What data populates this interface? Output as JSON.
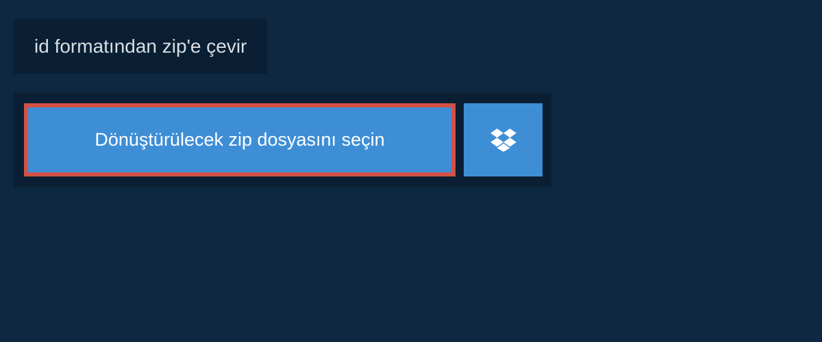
{
  "title": "id formatından zip'e çevir",
  "upload": {
    "select_file_label": "Dönüştürülecek zip dosyasını seçin"
  },
  "colors": {
    "background": "#0d2840",
    "panel": "#0a1f33",
    "button": "#3e8ed6",
    "highlight_border": "#d35147",
    "text_light": "#d8dfe6",
    "text_white": "#ffffff"
  }
}
